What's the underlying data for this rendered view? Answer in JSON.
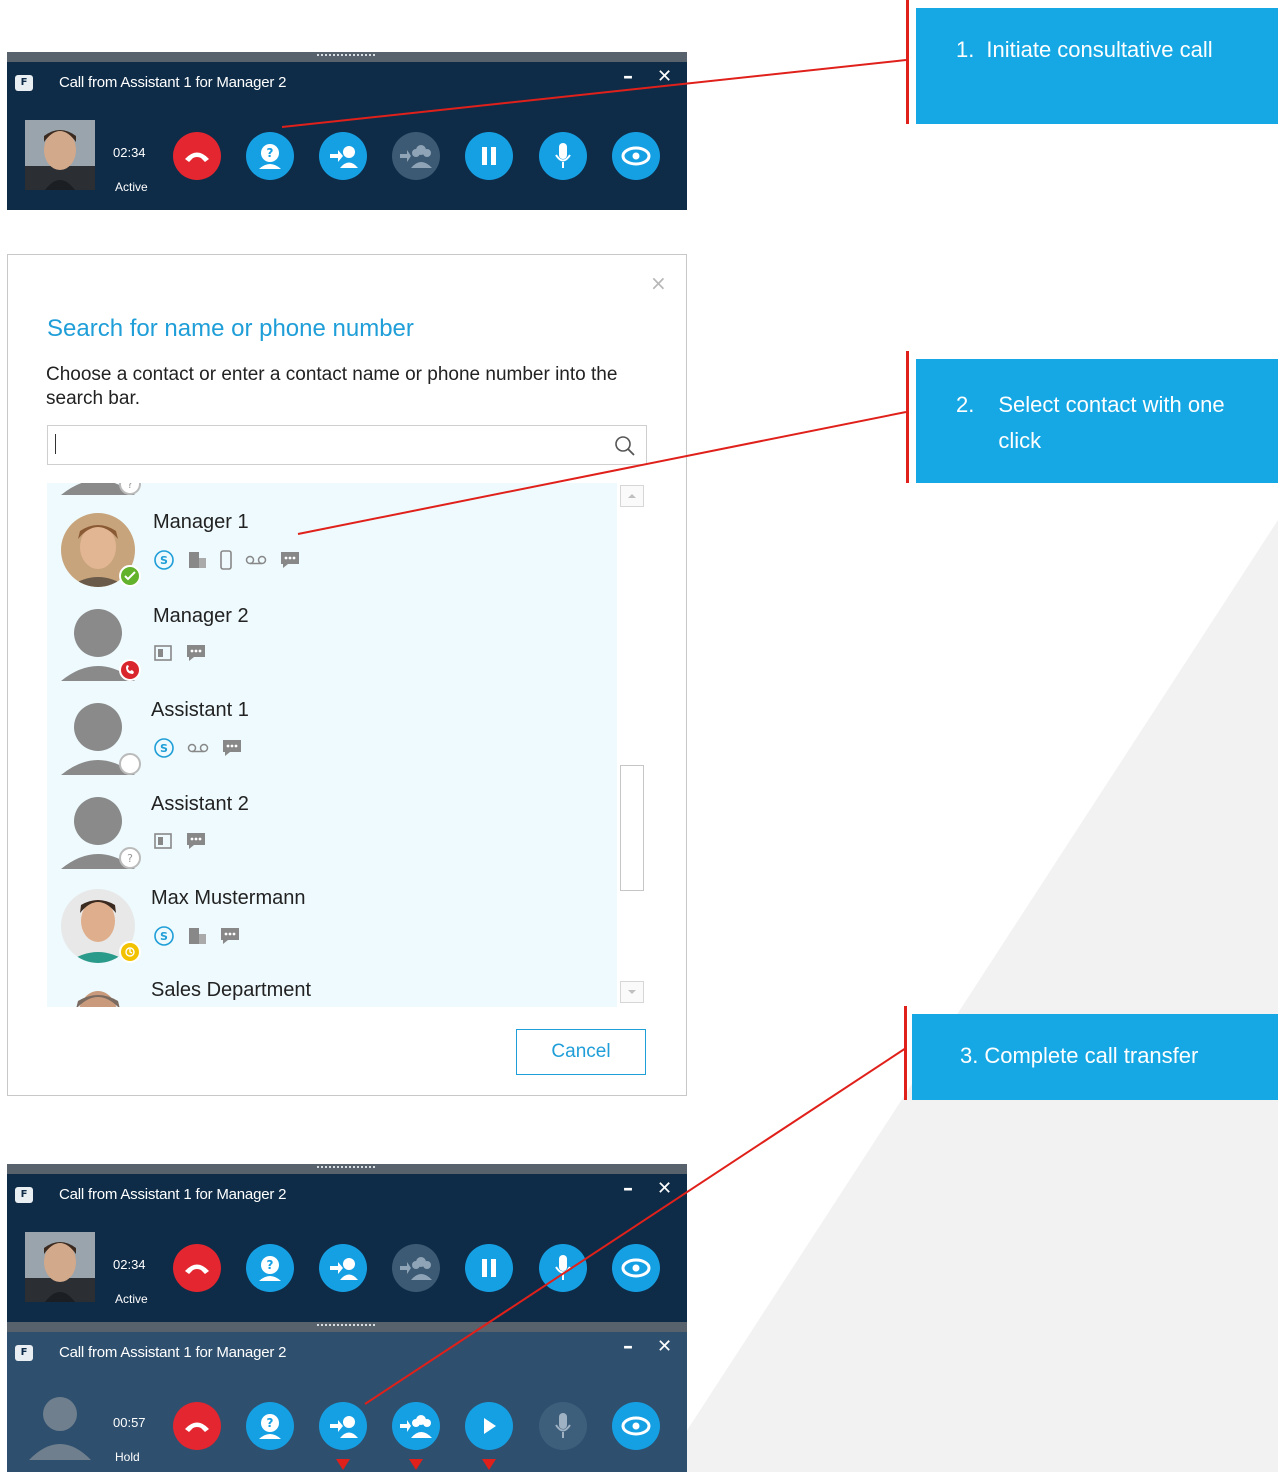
{
  "call_window_1": {
    "title": "Call from Assistant 1 for Manager 2",
    "minimize": "–",
    "close": "✕",
    "timer": "02:34",
    "state": "Active",
    "hold_icon": "pause-icon"
  },
  "search_dialog": {
    "close": "×",
    "title": "Search for name or phone number",
    "description": "Choose a contact or enter a contact name or phone number into the search bar.",
    "search_value": "",
    "contacts": [
      {
        "name": "Manager 1",
        "presence": "available"
      },
      {
        "name": "Manager 2",
        "presence": "in-call"
      },
      {
        "name": "Assistant 1",
        "presence": "offline"
      },
      {
        "name": "Assistant 2",
        "presence": "unknown"
      },
      {
        "name": "Max Mustermann",
        "presence": "away"
      },
      {
        "name": "Sales Department",
        "presence": ""
      }
    ],
    "cancel_label": "Cancel"
  },
  "call_window_2": {
    "title": "Call from Assistant 1 for Manager 2",
    "minimize": "–",
    "close": "✕",
    "timer": "02:34",
    "state": "Active"
  },
  "call_window_3": {
    "title": "Call from Assistant 1 for Manager 2",
    "minimize": "–",
    "close": "✕",
    "timer": "00:57",
    "state": "Hold",
    "hold_icon": "play-icon"
  },
  "callouts": [
    {
      "num": "1.",
      "text": "Initiate consultative call"
    },
    {
      "num": "2.",
      "text": "Select contact with one click"
    },
    {
      "num": "3.",
      "text": "Complete call transfer"
    }
  ],
  "colors": {
    "call_bar": "#0e2c48",
    "call_bar_hold": "#2e4f6e",
    "action_blue": "#16a0e4",
    "hangup_red": "#e3262f",
    "callout_blue": "#16a8e4",
    "annotation_red": "#e0201a"
  }
}
